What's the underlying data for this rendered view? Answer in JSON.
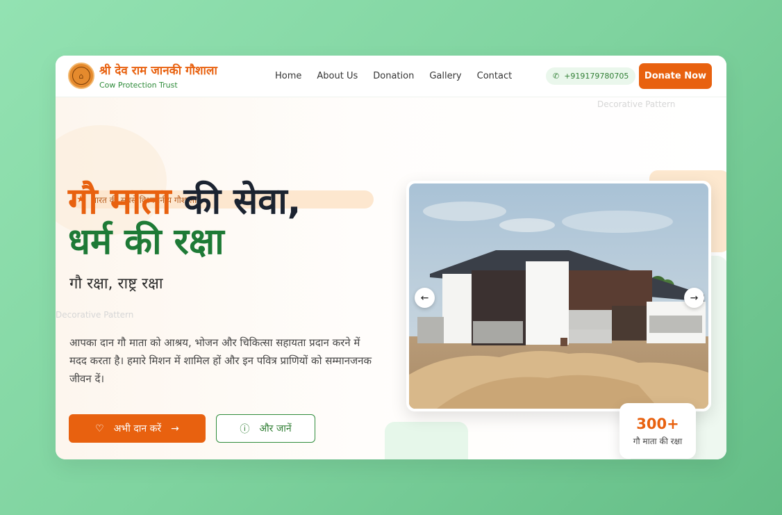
{
  "brand": {
    "title": "श्री देव राम जानकी गौशाला",
    "subtitle": "Cow Protection Trust",
    "logo_icon": "temple-emblem-icon"
  },
  "nav": {
    "items": [
      {
        "label": "Home"
      },
      {
        "label": "About Us"
      },
      {
        "label": "Donation"
      },
      {
        "label": "Gallery"
      },
      {
        "label": "Contact"
      }
    ],
    "phone": "+919179780705",
    "phone_icon": "phone-icon",
    "donate_label": "Donate Now"
  },
  "decorative": {
    "alt1": "Decorative Pattern",
    "alt2": "Decorative Pattern"
  },
  "hero": {
    "tag": "भारत की सबसे विश्वसनीय गौशाला",
    "title_orange": "गौ माता",
    "title_dark": "की सेवा,",
    "title_green": "धर्म की रक्षा",
    "tagline": "गौ रक्षा, राष्ट्र रक्षा",
    "description": "आपका दान गौ माता को आश्रय, भोजन और चिकित्सा सहायता प्रदान करने में मदद करता है। हमारे मिशन में शामिल हों और इन पवित्र प्राणियों को सम्मानजनक जीवन दें।",
    "primary_btn": "अभी दान करें",
    "secondary_btn": "और जानें"
  },
  "stat": {
    "number": "300+",
    "label": "गौ माता की रक्षा"
  },
  "colors": {
    "accent": "#e8610f",
    "green": "#1e7a36",
    "dark": "#1b2330"
  }
}
